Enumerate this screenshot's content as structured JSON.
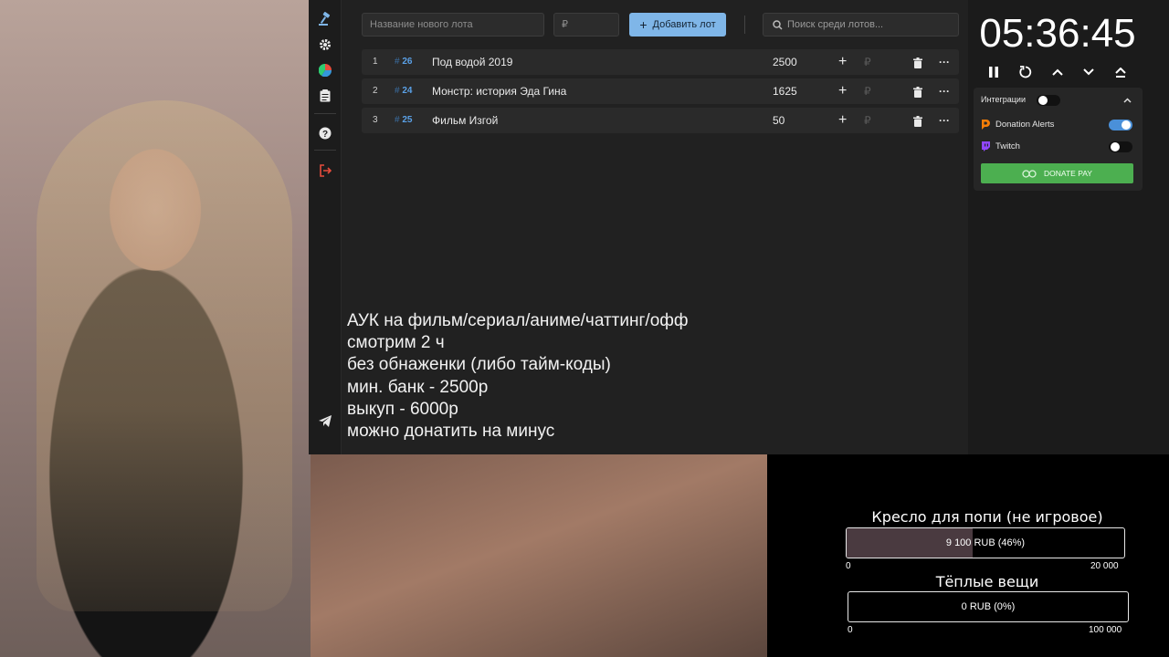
{
  "app": {
    "lot_name_placeholder": "Название нового лота",
    "amount_placeholder": "₽",
    "add_label": "Добавить лот",
    "search_placeholder": "Поиск среди лотов...",
    "lots": [
      {
        "index": "1",
        "id": "26",
        "name": "Под водой 2019",
        "amount": "2500"
      },
      {
        "index": "2",
        "id": "24",
        "name": "Монстр: история Эда Гина",
        "amount": "1625"
      },
      {
        "index": "3",
        "id": "25",
        "name": "Фильм Изгой",
        "amount": "50"
      }
    ],
    "rub_symbol": "₽"
  },
  "notes": {
    "lines": [
      "АУК на фильм/сериал/аниме/чаттинг/офф",
      "смотрим 2 ч",
      "без обнаженки (либо тайм-коды)",
      "мин. банк - 2500р",
      "выкуп - 6000р",
      "можно донатить на минус"
    ]
  },
  "timer": {
    "time": "05:36:45"
  },
  "integrations": {
    "title": "Интеграции",
    "enabled": false,
    "services": [
      {
        "name": "Donation Alerts",
        "enabled": true,
        "color": "#f57d07"
      },
      {
        "name": "Twitch",
        "enabled": false,
        "color": "#9146ff"
      }
    ],
    "donatepay_label": "DONATE PAY"
  },
  "goals": [
    {
      "title": "Кресло для попи (не игровое)",
      "label": "9 100 RUB (46%)",
      "min": "0",
      "max": "20 000",
      "progress": 0.455
    },
    {
      "title": "Тёплые вещи",
      "label": "0 RUB (0%)",
      "min": "0",
      "max": "100 000",
      "progress": 0
    }
  ],
  "colors": {
    "accent": "#7fb6e8",
    "id_blue": "#5aa0e6",
    "donatepay_green": "#4caf50",
    "toggle_on": "#4a90d9"
  }
}
